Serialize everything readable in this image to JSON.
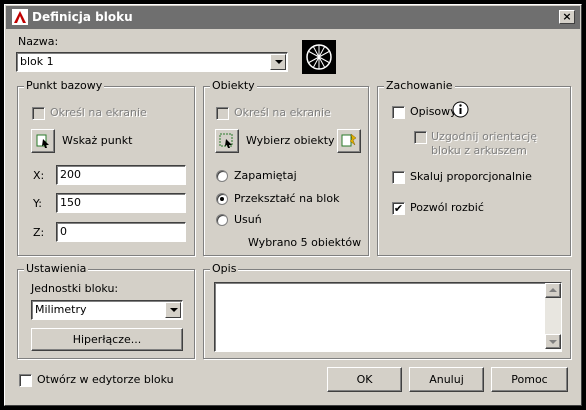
{
  "window": {
    "title": "Definicja bloku",
    "close_glyph": "×"
  },
  "name": {
    "label": "Nazwa:",
    "value": "blok 1"
  },
  "base_point": {
    "legend": "Punkt bazowy",
    "specify_on_screen": "Określ na ekranie",
    "pick_point": "Wskaż punkt",
    "x_label": "X:",
    "x_value": "200",
    "y_label": "Y:",
    "y_value": "150",
    "z_label": "Z:",
    "z_value": "0"
  },
  "objects": {
    "legend": "Obiekty",
    "specify_on_screen": "Określ na ekranie",
    "select_objects": "Wybierz obiekty",
    "retain": "Zapamiętaj",
    "convert_to_block": "Przekształć na blok",
    "delete": "Usuń",
    "selected_count": "Wybrano 5 obiektów",
    "selected_option": "convert_to_block"
  },
  "behavior": {
    "legend": "Zachowanie",
    "annotative": "Opisowy",
    "match_orientation_line1": "Uzgodnij orientację",
    "match_orientation_line2": "bloku z arkuszem",
    "scale_uniformly": "Skaluj proporcjonalnie",
    "allow_exploding": "Pozwól rozbić",
    "annotative_checked": false,
    "scale_uniformly_checked": false,
    "allow_exploding_checked": true,
    "check_glyph": "✔"
  },
  "settings": {
    "legend": "Ustawienia",
    "units_label": "Jednostki bloku:",
    "units_value": "Milimetry",
    "hyperlink_button": "Hiperłącze..."
  },
  "description": {
    "legend": "Opis",
    "value": ""
  },
  "footer": {
    "open_in_editor": "Otwórz w edytorze bloku",
    "ok": "OK",
    "cancel": "Anuluj",
    "help": "Pomoc"
  },
  "icons": {
    "app": "autocad-app-icon",
    "preview": "block-preview-icon",
    "pick_point": "pick-point-icon",
    "select_objects": "select-objects-icon",
    "quick_select": "quick-select-icon",
    "info": "info-icon"
  },
  "colors": {
    "title_bar": "#6f6f6f",
    "dialog_bg": "#d4d0c8"
  }
}
